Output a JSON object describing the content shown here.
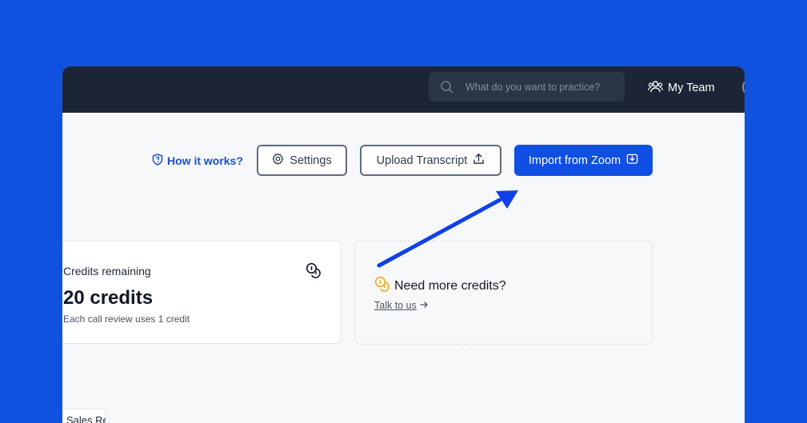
{
  "topbar": {
    "search_placeholder": "What do you want to practice?",
    "search_icon": "search-icon",
    "team_label": "My Team",
    "team_icon": "users-icon"
  },
  "toolbar": {
    "how_it_works_label": "How it works?",
    "how_it_works_icon": "shield-icon",
    "settings_label": "Settings",
    "settings_icon": "gear-icon",
    "upload_label": "Upload Transcript",
    "upload_icon": "upload-icon",
    "import_label": "Import from Zoom",
    "import_icon": "download-icon"
  },
  "credits_card": {
    "label": "Credits remaining",
    "value": "20 credits",
    "note": "Each call review uses 1 credit",
    "icon": "coins-icon"
  },
  "more_credits": {
    "title": "Need more credits?",
    "link": "Talk to us",
    "icon": "coins-icon",
    "link_icon": "arrow-right-icon"
  },
  "bottom_chip": {
    "label": "Sales Rep"
  },
  "colors": {
    "background": "#1052df",
    "topbar": "#1b2535",
    "primary": "#0f4fe3",
    "link": "#1a4fd6",
    "coin_accent": "#f0a81c",
    "annotation_arrow": "#1040e8"
  }
}
